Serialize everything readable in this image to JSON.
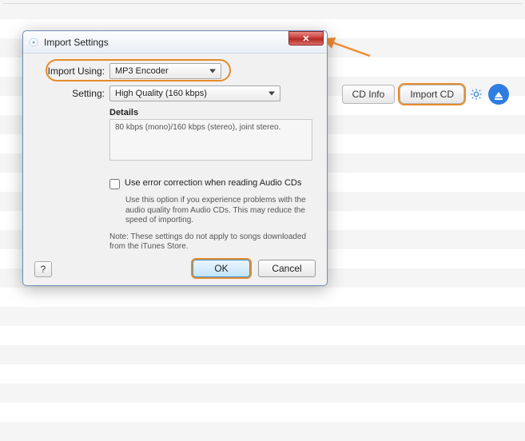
{
  "toolbar": {
    "cd_info_label": "CD Info",
    "import_cd_label": "Import CD"
  },
  "dialog": {
    "title": "Import Settings",
    "import_using_label": "Import Using:",
    "import_using_value": "MP3 Encoder",
    "setting_label": "Setting:",
    "setting_value": "High Quality (160 kbps)",
    "details_header": "Details",
    "details_text": "80 kbps (mono)/160 kbps (stereo), joint stereo.",
    "error_correction_label": "Use error correction when reading Audio CDs",
    "error_correction_hint": "Use this option if you experience problems with the audio quality from Audio CDs.  This may reduce the speed of importing.",
    "note_text": "Note: These settings do not apply to songs downloaded from the iTunes Store.",
    "help_label": "?",
    "ok_label": "OK",
    "cancel_label": "Cancel"
  }
}
